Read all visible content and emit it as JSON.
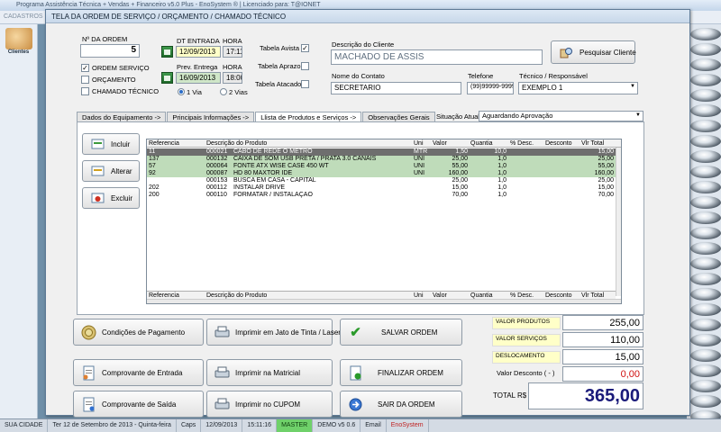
{
  "background": {
    "title": "Programa Assistência Técnica + Vendas + Financeiro v5.0 Plus - EnoSystem ® | Licenciado para: T@IONET",
    "menu": "CADASTROS",
    "side_label": "Clientes",
    "taskbar": [
      "SUA CIDADE",
      "Ter 12 de Setembro de 2013 - Quinta-feira",
      "Caps",
      "12/09/2013",
      "15:11:16",
      "MASTER",
      "DEMO v5 0.6",
      "Email",
      "EnoSystem"
    ]
  },
  "dialog": {
    "title": "TELA DA ORDEM DE SERVIÇO / ORÇAMENTO / CHAMADO TÉCNICO",
    "order_number_label": "Nº DA ORDEM",
    "order_number": "5",
    "type_options": [
      {
        "label": "ORDEM SERVIÇO",
        "checked": true
      },
      {
        "label": "ORÇAMENTO",
        "checked": false
      },
      {
        "label": "CHAMADO TÉCNICO",
        "checked": false
      }
    ],
    "dt_entrada_label": "DT ENTRADA",
    "dt_entrada": "12/09/2013",
    "hora_label": "HORA",
    "hora_entrada": "17:11",
    "prev_entrega_label": "Prev. Entrega",
    "prev_entrega": "16/09/2013",
    "hora2_label": "HORA",
    "hora_entrega": "18:00",
    "via_options": [
      {
        "label": "1 Via",
        "selected": true
      },
      {
        "label": "2 Vias",
        "selected": false
      }
    ],
    "tabela_avista": {
      "label": "Tabela Avista",
      "checked": true
    },
    "tabela_aprazo": {
      "label": "Tabela Aprazo",
      "checked": false
    },
    "tabela_atacado": {
      "label": "Tabela Atacado",
      "checked": false
    },
    "cliente_label": "Descrição do Cliente",
    "cliente": "MACHADO DE ASSIS",
    "pesquisar_label": "Pesquisar Cliente",
    "contato_label": "Nome do Contato",
    "contato": "SECRETARIO",
    "telefone_label": "Telefone",
    "telefone": "(99)99999-9999",
    "tecnico_label": "Técnico / Responsável",
    "tecnico": "EXEMPLO 1",
    "tabs": [
      "Dados do Equipamento ->",
      "Principais Informações ->",
      "Llista de Produtos e Serviços ->",
      "Observações Gerais"
    ],
    "situacao_label": "Situação Atual:",
    "situacao": "Aguardando Aprovação",
    "grid_buttons": {
      "incluir": "Incluir",
      "alterar": "Alterar",
      "excluir": "Excluir"
    },
    "grid_headers": [
      "Referencia",
      "Descrição do Produto",
      "Uni",
      "Valor",
      "Quantia",
      "% Desc.",
      "Desconto",
      "Vlr Total"
    ],
    "grid_rows": [
      {
        "ref": "11",
        "code": "000021",
        "desc": "CABO DE REDE O METRO",
        "uni": "MTR",
        "valor": "1,50",
        "qtd": "10,0",
        "pdesc": "",
        "desc_val": "",
        "total": "15,00"
      },
      {
        "ref": "137",
        "code": "000132",
        "desc": "CAIXA DE SOM USB PRETA / PRATA 3.0 CANAIS",
        "uni": "UNI",
        "valor": "25,00",
        "qtd": "1,0",
        "pdesc": "",
        "desc_val": "",
        "total": "25,00"
      },
      {
        "ref": "57",
        "code": "000064",
        "desc": "FONTE  ATX  WISE  CASE  450 WT",
        "uni": "UNI",
        "valor": "55,00",
        "qtd": "1,0",
        "pdesc": "",
        "desc_val": "",
        "total": "55,00"
      },
      {
        "ref": "92",
        "code": "000087",
        "desc": "HD  80  MAXTOR  IDE",
        "uni": "UNI",
        "valor": "160,00",
        "qtd": "1,0",
        "pdesc": "",
        "desc_val": "",
        "total": "160,00"
      },
      {
        "ref": "",
        "code": "000153",
        "desc": "BUSCA EM CASA - CAPITAL",
        "uni": "",
        "valor": "25,00",
        "qtd": "1,0",
        "pdesc": "",
        "desc_val": "",
        "total": "25,00"
      },
      {
        "ref": "202",
        "code": "000112",
        "desc": "INSTALAR  DRIVE",
        "uni": "",
        "valor": "15,00",
        "qtd": "1,0",
        "pdesc": "",
        "desc_val": "",
        "total": "15,00"
      },
      {
        "ref": "200",
        "code": "000110",
        "desc": "FORMATAR  /  INSTALAÇÃO",
        "uni": "",
        "valor": "70,00",
        "qtd": "1,0",
        "pdesc": "",
        "desc_val": "",
        "total": "70,00"
      }
    ],
    "grid_footer": [
      "Referencia",
      "Descrição do Produto",
      "Uni",
      "Valor",
      "Quantia",
      "% Desc.",
      "Desconto",
      "Vlr Total"
    ],
    "actions": {
      "condicoes": "Condições de Pagamento",
      "comprovante_entrada": "Comprovante de Entrada",
      "comprovante_saida": "Comprovante de Saída",
      "imprimir_jato": "Imprimir em Jato de Tinta / Laser",
      "imprimir_matricial": "Imprimir na Matricial",
      "imprimir_cupom": "Imprimir no CUPOM",
      "salvar": "SALVAR ORDEM",
      "finalizar": "FINALIZAR ORDEM",
      "sair": "SAIR DA ORDEM"
    },
    "totals": {
      "produtos_label": "VALOR PRODUTOS",
      "produtos": "255,00",
      "servicos_label": "VALOR SERVIÇOS",
      "servicos": "110,00",
      "deslocamento_label": "DESLOCAMENTO",
      "deslocamento": "15,00",
      "desconto_label": "Valor Desconto ( - )",
      "desconto": "0,00",
      "total_label": "TOTAL R$",
      "total": "365,00"
    }
  }
}
